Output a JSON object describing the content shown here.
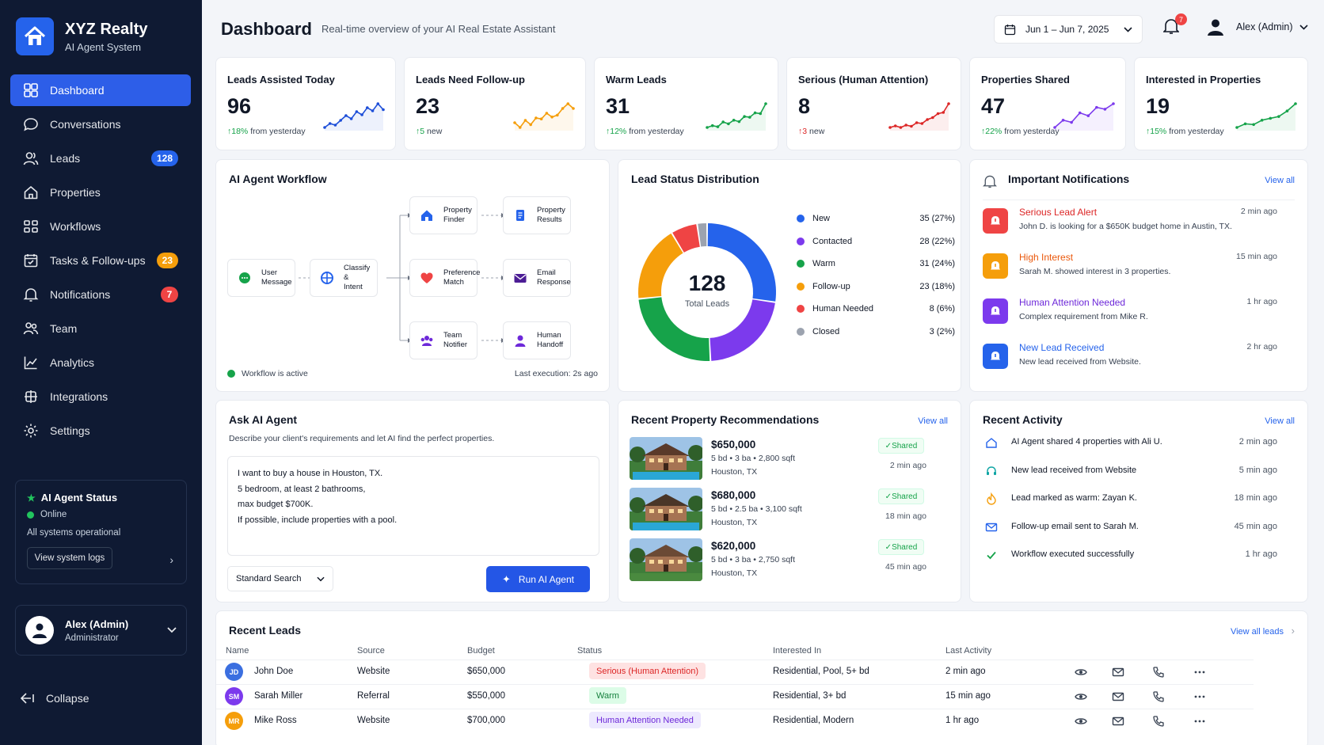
{
  "brand": {
    "title": "XYZ Realty",
    "subtitle": "AI Agent System"
  },
  "sidebar": {
    "items": [
      {
        "label": "Dashboard",
        "icon": "grid-icon"
      },
      {
        "label": "Conversations",
        "icon": "chat-icon"
      },
      {
        "label": "Leads",
        "icon": "users-icon",
        "badge": "128"
      },
      {
        "label": "Properties",
        "icon": "home-icon"
      },
      {
        "label": "Workflows",
        "icon": "workflow-icon"
      },
      {
        "label": "Tasks & Follow-ups",
        "icon": "calendar-check-icon",
        "badge": "23"
      },
      {
        "label": "Notifications",
        "icon": "bell-icon",
        "badge": "7"
      },
      {
        "label": "Team",
        "icon": "team-icon"
      },
      {
        "label": "Analytics",
        "icon": "chart-icon"
      },
      {
        "label": "Integrations",
        "icon": "integrations-icon"
      },
      {
        "label": "Settings",
        "icon": "gear-icon"
      }
    ],
    "status": {
      "title": "AI Agent Status",
      "online": "Online",
      "detail": "All systems operational",
      "logs_button": "View system logs"
    },
    "user": {
      "name": "Alex (Admin)",
      "role": "Administrator"
    },
    "collapse_label": "Collapse"
  },
  "header": {
    "title": "Dashboard",
    "subtitle": "Real-time overview of your AI Real Estate Assistant",
    "date_range": "Jun 1 – Jun 7, 2025",
    "notification_count": "7",
    "user_name": "Alex (Admin)"
  },
  "stats": [
    {
      "title": "Leads Assisted Today",
      "value": "96",
      "delta": "18%",
      "delta_text": "from yesterday",
      "trend": "up",
      "color": "#1d4ed8",
      "spark": [
        3,
        4,
        3.6,
        4.8,
        6,
        5.2,
        7,
        6.2,
        8,
        7.2,
        9,
        7.5
      ]
    },
    {
      "title": "Leads Need Follow-up",
      "value": "23",
      "delta": "5",
      "delta_text": "new",
      "trend": "up",
      "color": "#f59e0b",
      "spark": [
        4,
        3,
        4.5,
        3.6,
        5,
        4.8,
        6,
        5.2,
        5.6,
        7,
        8,
        7
      ]
    },
    {
      "title": "Warm Leads",
      "value": "31",
      "delta": "12%",
      "delta_text": "from yesterday",
      "trend": "up",
      "color": "#16a34a",
      "spark": [
        3,
        3.5,
        3.2,
        4.5,
        4,
        5,
        4.6,
        6,
        5.8,
        7,
        6.8,
        9.5
      ]
    },
    {
      "title": "Serious (Human Attention)",
      "value": "8",
      "delta": "3",
      "delta_text": "new",
      "trend": "up-red",
      "color": "#dc2626",
      "spark": [
        3,
        3.4,
        3,
        3.6,
        3.3,
        4.2,
        4,
        5,
        5.5,
        6.5,
        6.8,
        9
      ]
    },
    {
      "title": "Properties Shared",
      "value": "47",
      "delta": "22%",
      "delta_text": "from yesterday",
      "trend": "up",
      "color": "#7c3aed",
      "spark": [
        2,
        4,
        3.4,
        6,
        5.2,
        7.5,
        7,
        8.5
      ]
    },
    {
      "title": "Interested in Properties",
      "value": "19",
      "delta": "15%",
      "delta_text": "from yesterday",
      "trend": "up",
      "color": "#16a34a",
      "spark": [
        2,
        3,
        2.8,
        4,
        4.5,
        5,
        6.5,
        8.5
      ]
    }
  ],
  "workflow": {
    "title": "AI Agent Workflow",
    "nodes": [
      {
        "label1": "User",
        "label2": "Message"
      },
      {
        "label1": "Classify &",
        "label2": "Intent"
      },
      {
        "label1": "Property",
        "label2": "Finder"
      },
      {
        "label1": "Property",
        "label2": "Results"
      },
      {
        "label1": "Preference",
        "label2": "Match"
      },
      {
        "label1": "Email",
        "label2": "Response"
      },
      {
        "label1": "Team",
        "label2": "Notifier"
      },
      {
        "label1": "Human",
        "label2": "Handoff"
      }
    ],
    "status": "Workflow is active",
    "last_exec": "Last execution: 2s ago"
  },
  "lead_status": {
    "title": "Lead Status Distribution",
    "total": "128",
    "total_label": "Total Leads",
    "items": [
      {
        "label": "New",
        "value": "35 (27%)",
        "count": 35,
        "color": "#2563eb"
      },
      {
        "label": "Contacted",
        "value": "28 (22%)",
        "count": 28,
        "color": "#7c3aed"
      },
      {
        "label": "Warm",
        "value": "31 (24%)",
        "count": 31,
        "color": "#16a34a"
      },
      {
        "label": "Follow-up",
        "value": "23 (18%)",
        "count": 23,
        "color": "#f59e0b"
      },
      {
        "label": "Human Needed",
        "value": "8 (6%)",
        "count": 8,
        "color": "#ef4444"
      },
      {
        "label": "Closed",
        "value": "3 (2%)",
        "count": 3,
        "color": "#9ca3af"
      }
    ]
  },
  "notifications": {
    "title": "Important Notifications",
    "view_all": "View all",
    "items": [
      {
        "title": "Serious Lead Alert",
        "desc": "John D. is looking for a $650K budget home in Austin, TX.",
        "time": "2 min ago",
        "color": "#dc2626",
        "bg": "#ef4444"
      },
      {
        "title": "High Interest",
        "desc": "Sarah M. showed interest in 3 properties.",
        "time": "15 min ago",
        "color": "#ea580c",
        "bg": "#f59e0b"
      },
      {
        "title": "Human Attention Needed",
        "desc": "Complex requirement from Mike R.",
        "time": "1 hr ago",
        "color": "#6d28d9",
        "bg": "#7c3aed"
      },
      {
        "title": "New Lead Received",
        "desc": "New lead received from Website.",
        "time": "2 hr ago",
        "color": "#2563eb",
        "bg": "#2563eb"
      }
    ]
  },
  "ask_agent": {
    "title": "Ask AI Agent",
    "subtitle": "Describe your client's requirements and let AI find the perfect properties.",
    "lines": [
      "I want to buy a house in Houston, TX.",
      "5 bedroom, at least 2 bathrooms,",
      "max budget $700K.",
      "If possible, include properties with a pool."
    ],
    "search_mode": "Standard Search",
    "run_button": "Run AI Agent"
  },
  "recommendations": {
    "title": "Recent Property Recommendations",
    "view_all": "View all",
    "items": [
      {
        "price": "$650,000",
        "specs": "5 bd  •  3 ba  •  2,800 sqft",
        "location": "Houston, TX",
        "badge": "Shared",
        "time": "2 min ago"
      },
      {
        "price": "$680,000",
        "specs": "5 bd  •  2.5 ba  •  3,100 sqft",
        "location": "Houston, TX",
        "badge": "Shared",
        "time": "18 min ago"
      },
      {
        "price": "$620,000",
        "specs": "5 bd  •  3 ba  •  2,750 sqft",
        "location": "Houston, TX",
        "badge": "Shared",
        "time": "45 min ago"
      }
    ]
  },
  "activity": {
    "title": "Recent Activity",
    "view_all": "View all",
    "items": [
      {
        "text": "AI Agent shared 4 properties with Ali U.",
        "time": "2 min ago",
        "icon": "home-icon"
      },
      {
        "text": "New lead received from Website",
        "time": "5 min ago",
        "icon": "headset-icon"
      },
      {
        "text": "Lead marked as warm: Zayan K.",
        "time": "18 min ago",
        "icon": "flame-icon"
      },
      {
        "text": "Follow-up email sent to Sarah M.",
        "time": "45 min ago",
        "icon": "mail-icon"
      },
      {
        "text": "Workflow executed successfully",
        "time": "1 hr ago",
        "icon": "check-icon"
      }
    ]
  },
  "leads_table": {
    "title": "Recent Leads",
    "view_all": "View all leads",
    "columns": [
      "Name",
      "Source",
      "Budget",
      "Status",
      "Interested In",
      "Last Activity"
    ],
    "rows": [
      {
        "initials": "JD",
        "name": "John Doe",
        "source": "Website",
        "budget": "$650,000",
        "status": "Serious (Human Attention)",
        "status_fg": "#dc2626",
        "status_bg": "#fee2e2",
        "interest": "Residential, Pool, 5+ bd",
        "last": "2 min ago",
        "avatar": "#3b6fe0"
      },
      {
        "initials": "SM",
        "name": "Sarah Miller",
        "source": "Referral",
        "budget": "$550,000",
        "status": "Warm",
        "status_fg": "#15803d",
        "status_bg": "#dcfce7",
        "interest": "Residential, 3+ bd",
        "last": "15 min ago",
        "avatar": "#7c3aed"
      },
      {
        "initials": "MR",
        "name": "Mike Ross",
        "source": "Website",
        "budget": "$700,000",
        "status": "Human Attention Needed",
        "status_fg": "#6d28d9",
        "status_bg": "#ede9fe",
        "interest": "Residential, Modern",
        "last": "1 hr ago",
        "avatar": "#f59e0b"
      }
    ]
  }
}
